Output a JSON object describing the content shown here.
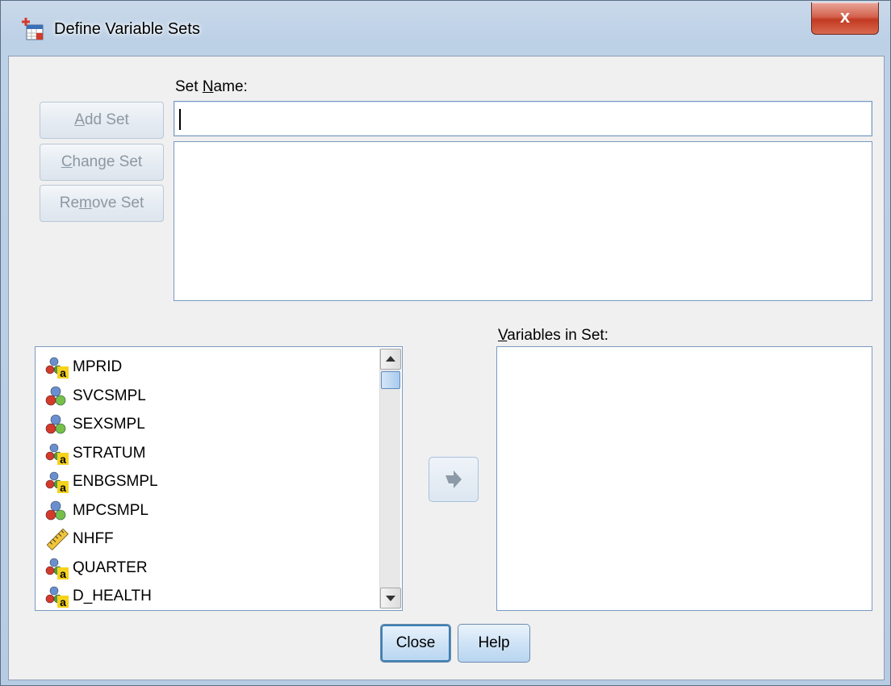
{
  "window": {
    "title": "Define Variable Sets",
    "close_glyph": "x"
  },
  "set_name": {
    "label_pre": "Set ",
    "label_mnemonic": "N",
    "label_post": "ame:",
    "value": ""
  },
  "side_buttons": {
    "add": {
      "pre": "",
      "mnemonic": "A",
      "post": "dd Set"
    },
    "change": {
      "pre": "",
      "mnemonic": "C",
      "post": "hange Set"
    },
    "remove": {
      "pre": "Re",
      "mnemonic": "m",
      "post": "ove Set"
    }
  },
  "variables_in_set": {
    "label_pre": "",
    "label_mnemonic": "V",
    "label_post": "ariables in Set:"
  },
  "variables": [
    {
      "name": "MPRID",
      "icon": "nominal-string-icon"
    },
    {
      "name": "SVCSMPL",
      "icon": "nominal-icon"
    },
    {
      "name": "SEXSMPL",
      "icon": "nominal-icon"
    },
    {
      "name": "STRATUM",
      "icon": "nominal-string-icon"
    },
    {
      "name": "ENBGSMPL",
      "icon": "nominal-string-icon"
    },
    {
      "name": "MPCSMPL",
      "icon": "nominal-icon"
    },
    {
      "name": "NHFF",
      "icon": "scale-ruler-icon"
    },
    {
      "name": "QUARTER",
      "icon": "nominal-string-icon"
    },
    {
      "name": "D_HEALTH",
      "icon": "nominal-string-icon"
    }
  ],
  "bottom_buttons": {
    "close": "Close",
    "help": "Help"
  }
}
